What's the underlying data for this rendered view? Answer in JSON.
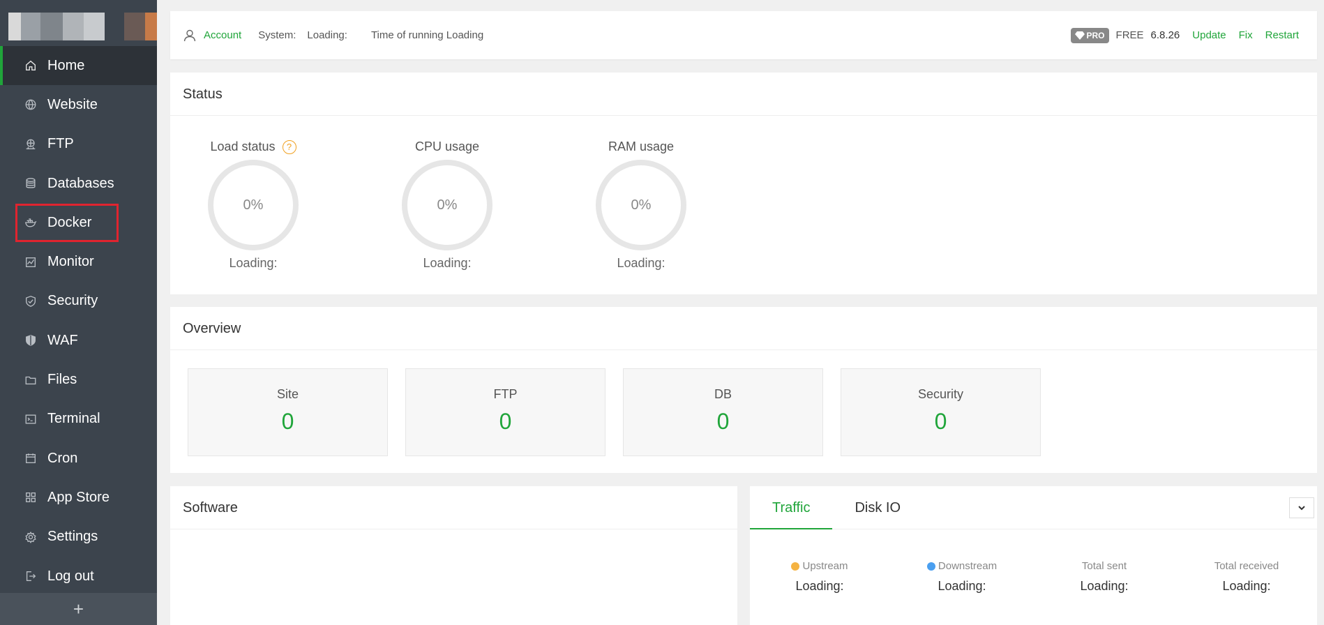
{
  "sidebar": {
    "items": [
      {
        "label": "Home",
        "icon": "home-icon"
      },
      {
        "label": "Website",
        "icon": "globe-icon"
      },
      {
        "label": "FTP",
        "icon": "ftp-icon"
      },
      {
        "label": "Databases",
        "icon": "database-icon"
      },
      {
        "label": "Docker",
        "icon": "docker-icon"
      },
      {
        "label": "Monitor",
        "icon": "monitor-icon"
      },
      {
        "label": "Security",
        "icon": "shield-check-icon"
      },
      {
        "label": "WAF",
        "icon": "shield-icon"
      },
      {
        "label": "Files",
        "icon": "folder-icon"
      },
      {
        "label": "Terminal",
        "icon": "terminal-icon"
      },
      {
        "label": "Cron",
        "icon": "calendar-icon"
      },
      {
        "label": "App Store",
        "icon": "grid-icon"
      },
      {
        "label": "Settings",
        "icon": "gear-icon"
      },
      {
        "label": "Log out",
        "icon": "logout-icon"
      }
    ],
    "footer": "+"
  },
  "topbar": {
    "account": "Account",
    "system_label": "System:",
    "system_value": "Loading:",
    "running": "Time of running Loading",
    "pro_badge": "PRO",
    "plan": "FREE",
    "version": "6.8.26",
    "update": "Update",
    "fix": "Fix",
    "restart": "Restart"
  },
  "status": {
    "title": "Status",
    "gauges": [
      {
        "label": "Load status",
        "value": "0%",
        "sub": "Loading:"
      },
      {
        "label": "CPU usage",
        "value": "0%",
        "sub": "Loading:"
      },
      {
        "label": "RAM usage",
        "value": "0%",
        "sub": "Loading:"
      }
    ],
    "help": "?"
  },
  "overview": {
    "title": "Overview",
    "cards": [
      {
        "title": "Site",
        "value": "0"
      },
      {
        "title": "FTP",
        "value": "0"
      },
      {
        "title": "DB",
        "value": "0"
      },
      {
        "title": "Security",
        "value": "0"
      }
    ]
  },
  "software": {
    "title": "Software"
  },
  "traffic": {
    "tabs": [
      "Traffic",
      "Disk IO"
    ],
    "stats": [
      {
        "label": "Upstream",
        "value": "Loading:",
        "dot": "#f5b342"
      },
      {
        "label": "Downstream",
        "value": "Loading:",
        "dot": "#4a9ff0"
      },
      {
        "label": "Total sent",
        "value": "Loading:"
      },
      {
        "label": "Total received",
        "value": "Loading:"
      }
    ]
  },
  "colors": {
    "accent": "#20a53a",
    "sidebar": "#3c444d",
    "highlight": "#e0242f"
  }
}
